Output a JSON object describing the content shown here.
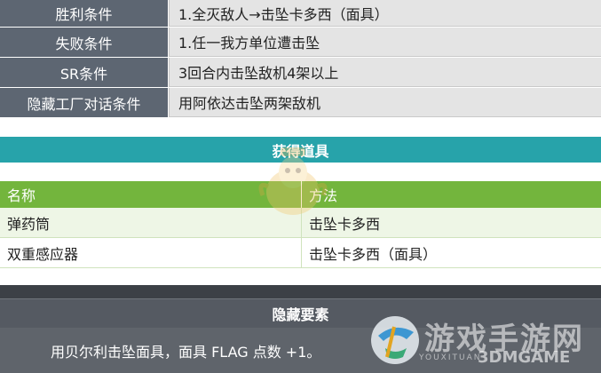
{
  "conditions": [
    {
      "label": "胜利条件",
      "value": "1.全灭敌人→击坠卡多西（面具）"
    },
    {
      "label": "失败条件",
      "value": "1.任一我方单位遭击坠"
    },
    {
      "label": "SR条件",
      "value": "3回合内击坠敌机4架以上"
    },
    {
      "label": "隐藏工厂对话条件",
      "value": "用阿依达击坠两架敌机"
    }
  ],
  "items_section": {
    "title": "获得道具",
    "headers": {
      "name": "名称",
      "method": "方法"
    },
    "rows": [
      {
        "name": "弹药筒",
        "method": "击坠卡多西"
      },
      {
        "name": "双重感应器",
        "method": "击坠卡多西（面具）"
      }
    ]
  },
  "hidden_section": {
    "title": "隐藏要素",
    "text": "用贝尔利击坠面具，面具 FLAG 点数 +1。"
  },
  "watermark": {
    "logo_text": "游戏手游网",
    "sub_text": "YOUXITUAN",
    "brand": "3DMGAME"
  },
  "colors": {
    "label_bg": "#5d6672",
    "teal": "#27a3aa",
    "green": "#73b53d",
    "dark": "#555a62"
  }
}
